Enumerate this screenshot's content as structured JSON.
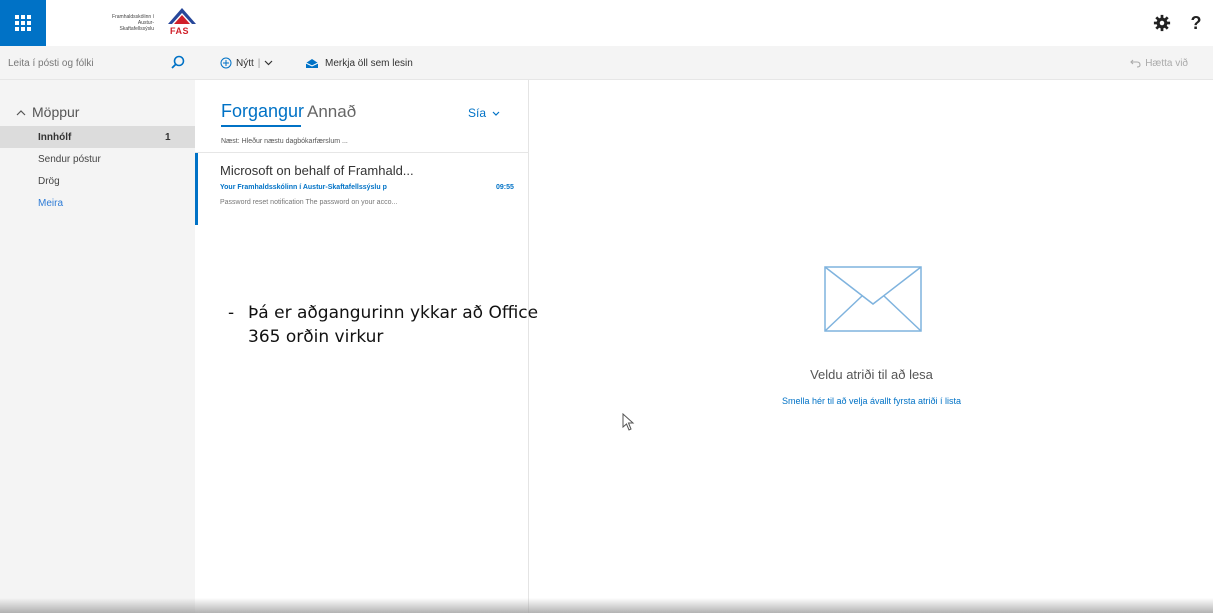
{
  "header": {
    "logo_text_line1": "Framhaldsskólinn í",
    "logo_text_line2": "Austur-Skaftafellssýslu",
    "logo_abbr": "FAS",
    "help_label": "?"
  },
  "toolbar": {
    "search_placeholder": "Leita í pósti og fólki",
    "new_label": "Nýtt",
    "new_dropdown": "|",
    "mark_all_read": "Merkja öll sem lesin",
    "undo": "Hætta við"
  },
  "folders": {
    "heading": "Möppur",
    "items": [
      {
        "label": "Innhólf",
        "count": "1"
      },
      {
        "label": "Sendur póstur"
      },
      {
        "label": "Drög"
      },
      {
        "label": "Meira"
      }
    ]
  },
  "message_list": {
    "tab_focused": "Forgangur",
    "tab_other": "Annað",
    "filter": "Sía",
    "next_event": "Næst: Hleður næstu dagbókarfærslum ...",
    "messages": [
      {
        "from": "Microsoft on behalf of Framhald...",
        "subject": "Your Framhaldsskólinn í Austur-Skaftafellssýslu p",
        "time": "09:55",
        "preview": "Password reset notification   The password on your acco..."
      }
    ]
  },
  "reading_pane": {
    "empty_text": "Veldu atriði til að lesa",
    "select_first_link": "Smella hér til að velja ávallt fyrsta atriði í lista"
  },
  "caption": {
    "dash": "-",
    "line1": "Þá er aðgangurinn ykkar að Office",
    "line2": "365 orðin virkur"
  },
  "colors": {
    "accent": "#0072c6",
    "pane_bg": "#f4f4f4",
    "selected_bg": "#dcdcdc",
    "logo_red": "#d0202a"
  }
}
